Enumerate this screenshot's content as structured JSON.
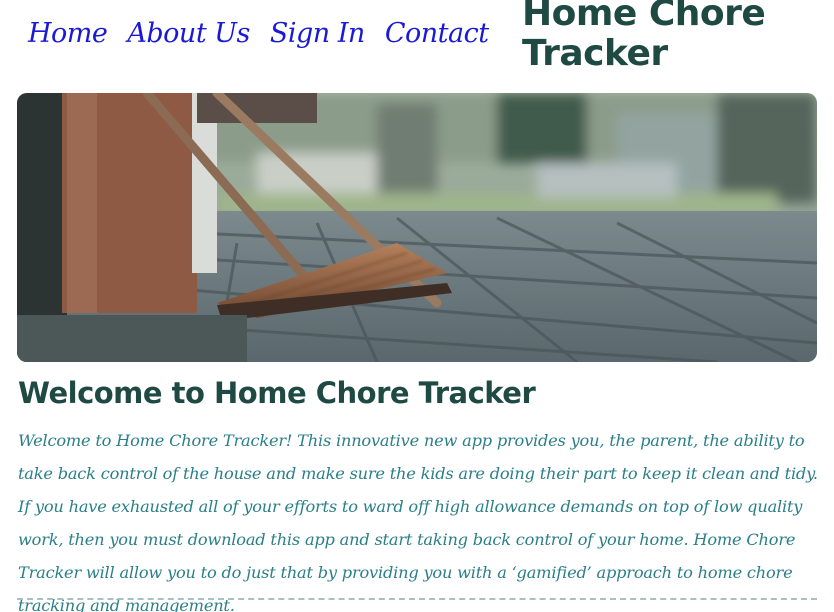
{
  "nav": {
    "items": [
      {
        "label": "Home"
      },
      {
        "label": "About Us"
      },
      {
        "label": "Sign In"
      },
      {
        "label": "Contact"
      }
    ]
  },
  "header": {
    "title": "Home Chore Tracker"
  },
  "main": {
    "heading": "Welcome to Home Chore Tracker",
    "intro": "Welcome to Home Chore Tracker! This innovative new app provides you, the parent, the ability to take back control of the house and make sure the kids are doing their part to keep it clean and tidy. If you have exhausted all of your efforts to ward off high allowance demands on top of low quality work, then you must download this app and start taking back control of your home. Home Chore Tracker will allow you to do just that by providing you with a ‘gamified’ approach to home chore tracking and management."
  },
  "colors": {
    "nav_link": "#1a1ad6",
    "title": "#1f4a44",
    "body_text": "#2a7f88"
  }
}
